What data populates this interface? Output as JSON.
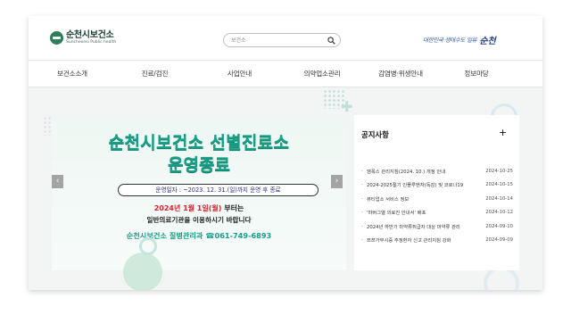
{
  "header": {
    "logo_kr": "순천시보건소",
    "logo_en": "Suncheonsi Public health",
    "search_placeholder": "보건소",
    "slogan_small": "대한민국 생태수도 일류",
    "slogan_big": "순천"
  },
  "gnb": [
    {
      "label": "보건소소개"
    },
    {
      "label": "진료/검진"
    },
    {
      "label": "사업안내"
    },
    {
      "label": "의약업소관리"
    },
    {
      "label": "감염병·위생안내"
    },
    {
      "label": "정보마당"
    }
  ],
  "banner": {
    "title": "순천시보건소 선별진료소",
    "subtitle": "운영종료",
    "period": "운영일자 : ~2023. 12. 31.(일)까지 운영 후 종료",
    "line1_highlight": "2024년 1월 1일(월)",
    "line1_rest": " 부터는",
    "line2": "일반의료기관을 이용하시기 바랍니다",
    "contact": "순천시보건소 질병관리과 ☎061-749-6893",
    "prev_label": "‹",
    "next_label": "›"
  },
  "notice": {
    "title": "공지사항",
    "more": "+",
    "items": [
      {
        "text": "엠폭스 관리지침(2024. 10.) 개정 안내",
        "date": "2024-10-25"
      },
      {
        "text": "2024-2025절기 인플루엔자(독감) 및 코로나19",
        "date": "2024-10-15"
      },
      {
        "text": "뷰티업소 서비스 정보",
        "date": "2024-10-14"
      },
      {
        "text": "'마버그열 의료진 안내서' 배포",
        "date": "2024-10-12"
      },
      {
        "text": "2024년 하반기 마약류취급자 대상 마약류 관리",
        "date": "2024-09-10"
      },
      {
        "text": "쯔쯔가무시증 주정환자 신고 관리지침 강화",
        "date": "2024-09-09"
      }
    ]
  },
  "colors": {
    "accent_green": "#18a087",
    "brand_dark": "#1d3c34",
    "highlight_red": "#d9232d",
    "slogan_blue": "#1f3e8c"
  }
}
